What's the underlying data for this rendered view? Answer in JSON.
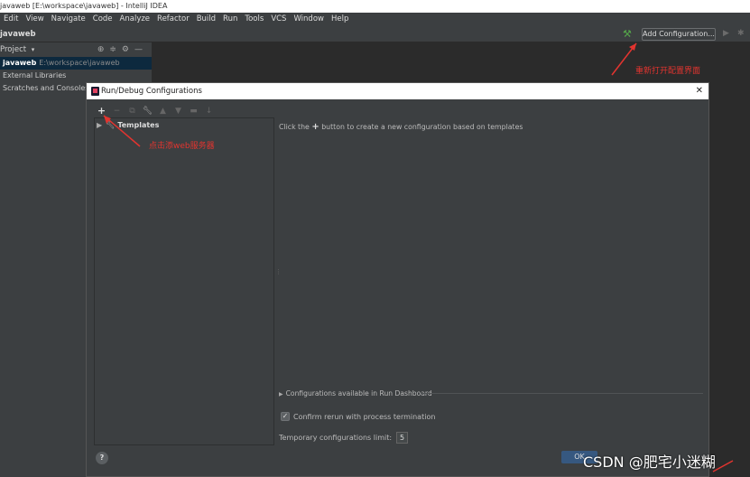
{
  "window": {
    "title": "javaweb [E:\\workspace\\javaweb] - IntelliJ IDEA"
  },
  "menu": {
    "items": [
      "Edit",
      "View",
      "Navigate",
      "Code",
      "Analyze",
      "Refactor",
      "Build",
      "Run",
      "Tools",
      "VCS",
      "Window",
      "Help"
    ]
  },
  "navbar": {
    "breadcrumb": "javaweb",
    "add_configuration": "Add Configuration..."
  },
  "project": {
    "header": "Project",
    "header_arrow": "▾",
    "items": [
      {
        "name": "javaweb",
        "path": "E:\\workspace\\javaweb",
        "selected": true
      },
      {
        "name": "External Libraries",
        "path": ""
      },
      {
        "name": "Scratches and Consoles",
        "path": ""
      }
    ]
  },
  "dialog": {
    "title": "Run/Debug Configurations",
    "close": "✕",
    "tree": {
      "templates_label": "Templates"
    },
    "hint_prefix": "Click the",
    "hint_suffix": "button to create a new configuration based on templates",
    "dashboard_label": "Configurations available in Run Dashboard",
    "confirm_label": "Confirm rerun with process termination",
    "confirm_checked": true,
    "limit_label": "Temporary configurations limit:",
    "limit_value": "5",
    "help": "?",
    "ok": "OK"
  },
  "annotations": {
    "reopen": "重新打开配置界面",
    "add_server": "点击添web服务器",
    "color": "#e3342f"
  },
  "watermark": "CSDN @肥宅小迷糊",
  "colors": {
    "background": "#2b2b2b",
    "panel": "#3c3f41",
    "selection": "#0d293e",
    "primary_button": "#365880"
  }
}
